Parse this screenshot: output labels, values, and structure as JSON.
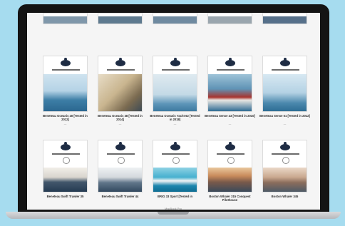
{
  "device": {
    "name": "MacBook Pro"
  },
  "row1": [
    {
      "label": "Beneteau Oceanis 40 [Tested in 2012]",
      "sub": "—"
    },
    {
      "label": "Beneteau Oceanis 38 [Tested in 2014]",
      "sub": "—"
    },
    {
      "label": "Beneteau Oceanis Yacht 62 [Tested in 2018]",
      "sub": "—"
    },
    {
      "label": "Beneteau Sense 43 [Tested in 2010]",
      "sub": "—"
    },
    {
      "label": "Beneteau Sense 51 [Tested in 2012]",
      "sub": "—"
    }
  ],
  "row2": [
    {
      "label": "Beneteau Swift Trawler 35",
      "sub": ""
    },
    {
      "label": "Beneteau Swift Trawler 44",
      "sub": ""
    },
    {
      "label": "BRIG 33 Sport [Tested in",
      "sub": ""
    },
    {
      "label": "Boston Whaler 315 Conquest Pilothouse",
      "sub": ""
    },
    {
      "label": "Boston Whaler 345",
      "sub": ""
    }
  ]
}
